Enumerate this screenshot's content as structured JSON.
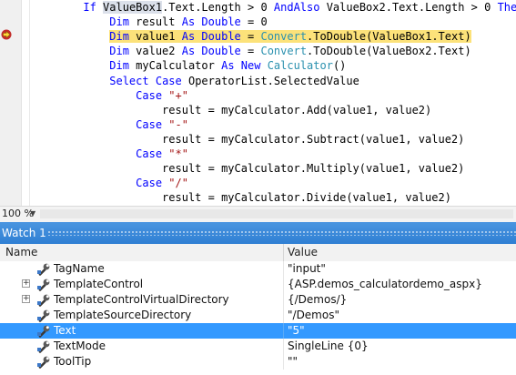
{
  "editor": {
    "lines": [
      {
        "indent": "      ",
        "parts": [
          {
            "t": "If ",
            "c": "kw"
          },
          {
            "t": "ValueBox1",
            "c": "hl-word"
          },
          {
            "t": ".Text.Length > 0 "
          },
          {
            "t": "AndAlso",
            "c": "kw"
          },
          {
            "t": " ValueBox2.Text.Length > 0 "
          },
          {
            "t": "Then",
            "c": "kw"
          }
        ]
      },
      {
        "indent": "          ",
        "parts": [
          {
            "t": "Dim",
            "c": "kw"
          },
          {
            "t": " result "
          },
          {
            "t": "As",
            "c": "kw"
          },
          {
            "t": " "
          },
          {
            "t": "Double",
            "c": "kw"
          },
          {
            "t": " = 0"
          }
        ]
      },
      {
        "indent": "          ",
        "stmt": true,
        "parts": [
          {
            "t": "Dim",
            "c": "kw"
          },
          {
            "t": " value1 "
          },
          {
            "t": "As",
            "c": "kw"
          },
          {
            "t": " "
          },
          {
            "t": "Double",
            "c": "kw"
          },
          {
            "t": " = "
          },
          {
            "t": "Convert",
            "c": "ty"
          },
          {
            "t": ".ToDouble(ValueBox1.Text)"
          }
        ]
      },
      {
        "indent": "          ",
        "parts": [
          {
            "t": "Dim",
            "c": "kw"
          },
          {
            "t": " value2 "
          },
          {
            "t": "As",
            "c": "kw"
          },
          {
            "t": " "
          },
          {
            "t": "Double",
            "c": "kw"
          },
          {
            "t": " = "
          },
          {
            "t": "Convert",
            "c": "ty"
          },
          {
            "t": ".ToDouble(ValueBox2.Text)"
          }
        ]
      },
      {
        "indent": "          ",
        "parts": [
          {
            "t": "Dim",
            "c": "kw"
          },
          {
            "t": " myCalculator "
          },
          {
            "t": "As",
            "c": "kw"
          },
          {
            "t": " "
          },
          {
            "t": "New",
            "c": "kw"
          },
          {
            "t": " "
          },
          {
            "t": "Calculator",
            "c": "ty"
          },
          {
            "t": "()"
          }
        ]
      },
      {
        "indent": "          ",
        "parts": [
          {
            "t": "Select",
            "c": "kw"
          },
          {
            "t": " "
          },
          {
            "t": "Case",
            "c": "kw"
          },
          {
            "t": " OperatorList.SelectedValue"
          }
        ]
      },
      {
        "indent": "              ",
        "parts": [
          {
            "t": "Case",
            "c": "kw"
          },
          {
            "t": " "
          },
          {
            "t": "\"+\"",
            "c": "st"
          }
        ]
      },
      {
        "indent": "                  ",
        "parts": [
          {
            "t": "result = myCalculator.Add(value1, value2)"
          }
        ]
      },
      {
        "indent": "              ",
        "parts": [
          {
            "t": "Case",
            "c": "kw"
          },
          {
            "t": " "
          },
          {
            "t": "\"-\"",
            "c": "st"
          }
        ]
      },
      {
        "indent": "                  ",
        "parts": [
          {
            "t": "result = myCalculator.Subtract(value1, value2)"
          }
        ]
      },
      {
        "indent": "              ",
        "parts": [
          {
            "t": "Case",
            "c": "kw"
          },
          {
            "t": " "
          },
          {
            "t": "\"*\"",
            "c": "st"
          }
        ]
      },
      {
        "indent": "                  ",
        "parts": [
          {
            "t": "result = myCalculator.Multiply(value1, value2)"
          }
        ]
      },
      {
        "indent": "              ",
        "parts": [
          {
            "t": "Case",
            "c": "kw"
          },
          {
            "t": " "
          },
          {
            "t": "\"/\"",
            "c": "st"
          }
        ]
      },
      {
        "indent": "                  ",
        "parts": [
          {
            "t": "result = myCalculator.Divide(value1, value2)"
          }
        ]
      }
    ],
    "current_statement_glyph": "current-statement-arrow-icon",
    "zoom": "100 %"
  },
  "watch": {
    "title": "Watch 1",
    "columns": {
      "name": "Name",
      "value": "Value"
    },
    "rows": [
      {
        "name": "TagName",
        "value": "\"input\"",
        "expandable": false,
        "icon": "property-wrench-icon"
      },
      {
        "name": "TemplateControl",
        "value": "{ASP.demos_calculatordemo_aspx}",
        "expandable": true,
        "icon": "property-wrench-icon"
      },
      {
        "name": "TemplateControlVirtualDirectory",
        "value": "{/Demos/}",
        "expandable": true,
        "icon": "property-wrench-icon"
      },
      {
        "name": "TemplateSourceDirectory",
        "value": "\"/Demos\"",
        "expandable": false,
        "icon": "property-wrench-icon"
      },
      {
        "name": "Text",
        "value": "\"5\"",
        "expandable": false,
        "icon": "property-wrench-icon",
        "selected": true
      },
      {
        "name": "TextMode",
        "value": "SingleLine {0}",
        "expandable": false,
        "icon": "property-wrench-icon"
      },
      {
        "name": "ToolTip",
        "value": "\"\"",
        "expandable": false,
        "icon": "property-wrench-icon"
      }
    ]
  },
  "colors": {
    "keyword": "#0000ff",
    "type": "#2b91af",
    "string": "#a31515",
    "current_statement": "#fce27a",
    "selection": "#3399ff",
    "watch_title": "#3d8bdb"
  }
}
